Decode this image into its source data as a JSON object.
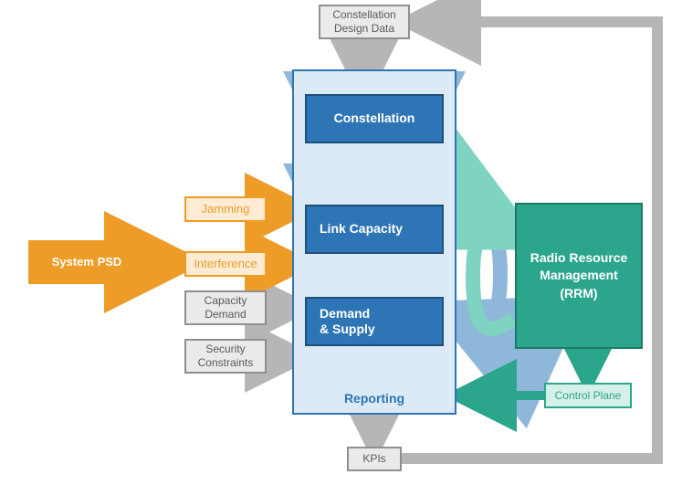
{
  "inputs": {
    "system_psd": "System PSD",
    "jamming": "Jamming",
    "interference": "Interference",
    "capacity_demand": "Capacity\nDemand",
    "security_constraints": "Security\nConstraints",
    "constellation_design_data": "Constellation\nDesign Data"
  },
  "pipeline": {
    "constellation": "Constellation",
    "link_capacity": "Link Capacity",
    "demand_supply": "Demand\n& Supply",
    "reporting_label": "Reporting"
  },
  "rrm": {
    "title": "Radio Resource\nManagement\n(RRM)",
    "control_plane": "Control Plane"
  },
  "outputs": {
    "kpis": "KPIs"
  },
  "colors": {
    "orange": "#ED9C28",
    "orange_light": "#FDEBD3",
    "grey_fill": "#EAEAEA",
    "grey_border": "#8F8F8F",
    "blue": "#2E75B6",
    "blue_dark": "#1F4E79",
    "blue_light": "#DBEAF5",
    "blue_mid": "#8FB7DA",
    "green": "#2CA58D",
    "green_light": "#D5F0E9",
    "green_mid": "#7FD4C1"
  }
}
